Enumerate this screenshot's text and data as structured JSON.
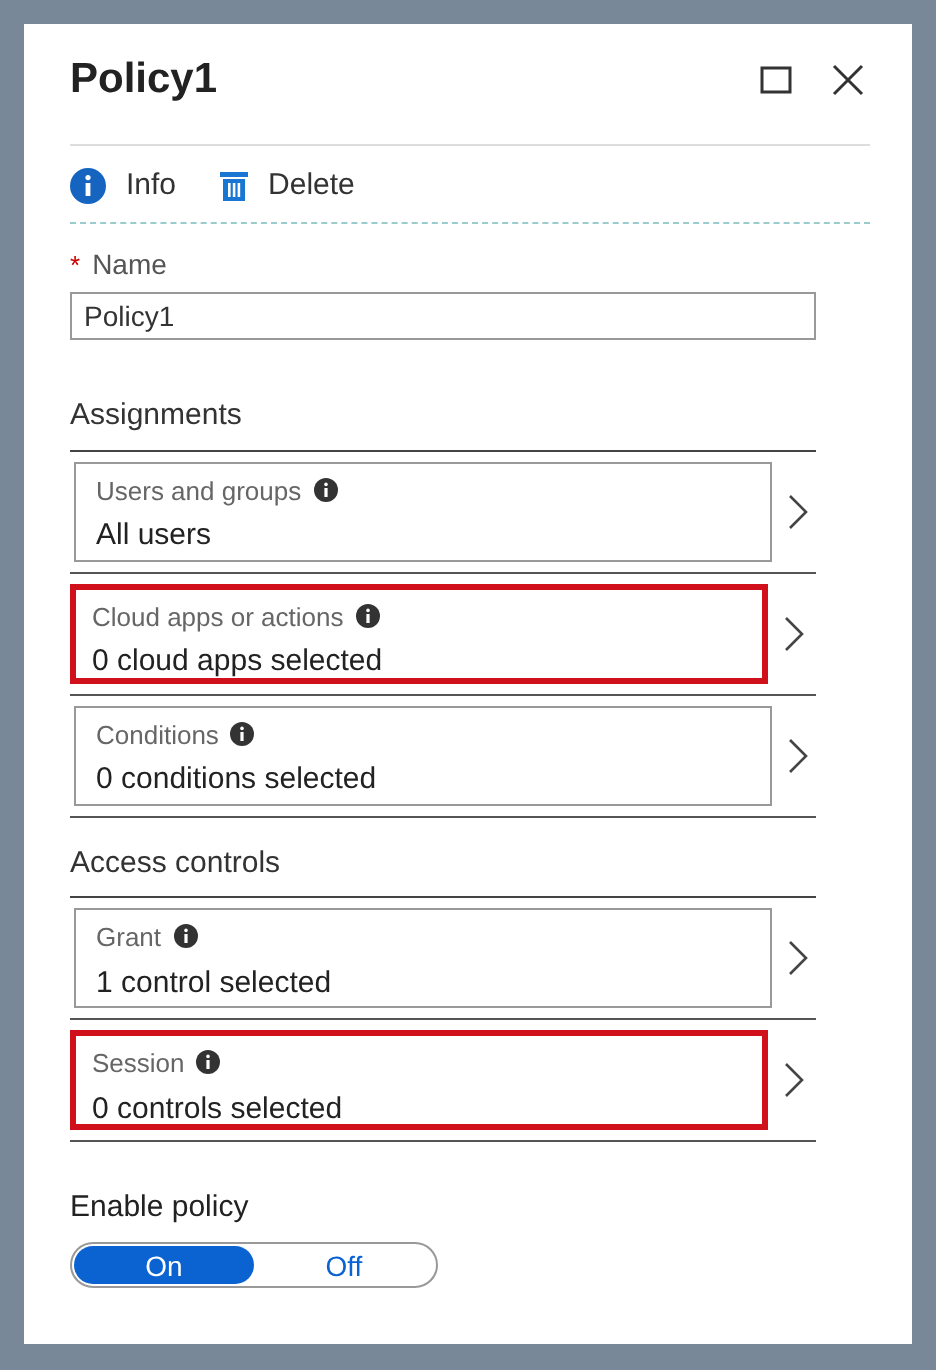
{
  "panel": {
    "title": "Policy1"
  },
  "toolbar": [
    {
      "kind": "info",
      "label": "Info"
    },
    {
      "kind": "delete",
      "label": "Delete"
    }
  ],
  "name_field": {
    "label": "Name",
    "required_mark": "*",
    "value": "Policy1"
  },
  "sections": [
    {
      "title": "Assignments",
      "items": [
        {
          "label": "Users and groups",
          "value": "All users",
          "highlighted": false
        },
        {
          "label": "Cloud apps or actions",
          "value": "0 cloud apps selected",
          "highlighted": true
        },
        {
          "label": "Conditions",
          "value": "0 conditions selected",
          "highlighted": false
        }
      ]
    },
    {
      "title": "Access controls",
      "items": [
        {
          "label": "Grant",
          "value": "1 control selected",
          "highlighted": false
        },
        {
          "label": "Session",
          "value": "0 controls selected",
          "highlighted": true
        }
      ]
    }
  ],
  "enable_policy": {
    "label": "Enable policy",
    "options": [
      {
        "label": "On",
        "selected": true
      },
      {
        "label": "Off",
        "selected": false
      }
    ]
  }
}
